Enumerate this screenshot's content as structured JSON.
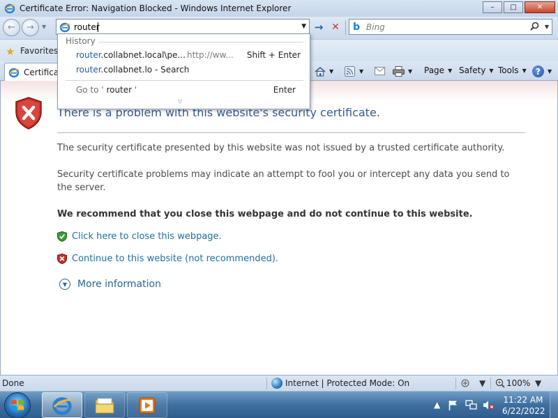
{
  "window": {
    "title": "Certificate Error: Navigation Blocked - Windows Internet Explorer",
    "minimize_glyph": "–",
    "maximize_glyph": "□",
    "close_glyph": "✕"
  },
  "nav": {
    "back_glyph": "←",
    "forward_glyph": "→",
    "address_value": "router",
    "go_glyph": "→",
    "stop_glyph": "✕"
  },
  "search": {
    "engine_glyph": "b",
    "placeholder": "Bing",
    "magnifier_glyph": "⚲"
  },
  "favorites": {
    "label": "Favorites"
  },
  "tab": {
    "label": "Certificate Error: Navigation Blocked"
  },
  "commands": {
    "page": "Page",
    "safety": "Safety",
    "tools": "Tools",
    "help_glyph": "?"
  },
  "autocomplete": {
    "history_label": "History",
    "items": [
      {
        "highlight": "router",
        "rest": ".collabnet.local\\pe...",
        "url": "http://ww...",
        "shortcut": "Shift + Enter"
      },
      {
        "highlight": "router",
        "rest": ".collabnet.lo - Search"
      }
    ],
    "goto_prefix": "Go to '",
    "goto_query": " router ",
    "goto_suffix": "'",
    "goto_shortcut": "Enter"
  },
  "page": {
    "title": "There is a problem with this website's security certificate.",
    "paragraph1": "The security certificate presented by this website was not issued by a trusted certificate authority.",
    "paragraph2": "Security certificate problems may indicate an attempt to fool you or intercept any data you send to the server.",
    "recommendation": "We recommend that you close this webpage and do not continue to this website.",
    "close_link": "Click here to close this webpage.",
    "continue_link": "Continue to this website (not recommended).",
    "more_info": "More information"
  },
  "status": {
    "text": "Done",
    "zone": "Internet | Protected Mode: On",
    "zoom": "100%"
  },
  "taskbar": {
    "time": "11:22 AM",
    "date": "6/22/2022"
  },
  "colors": {
    "link": "#1f6f9e",
    "title_blue": "#355a8f",
    "shield_red": "#c8302c",
    "shield_green": "#3f9a35"
  }
}
